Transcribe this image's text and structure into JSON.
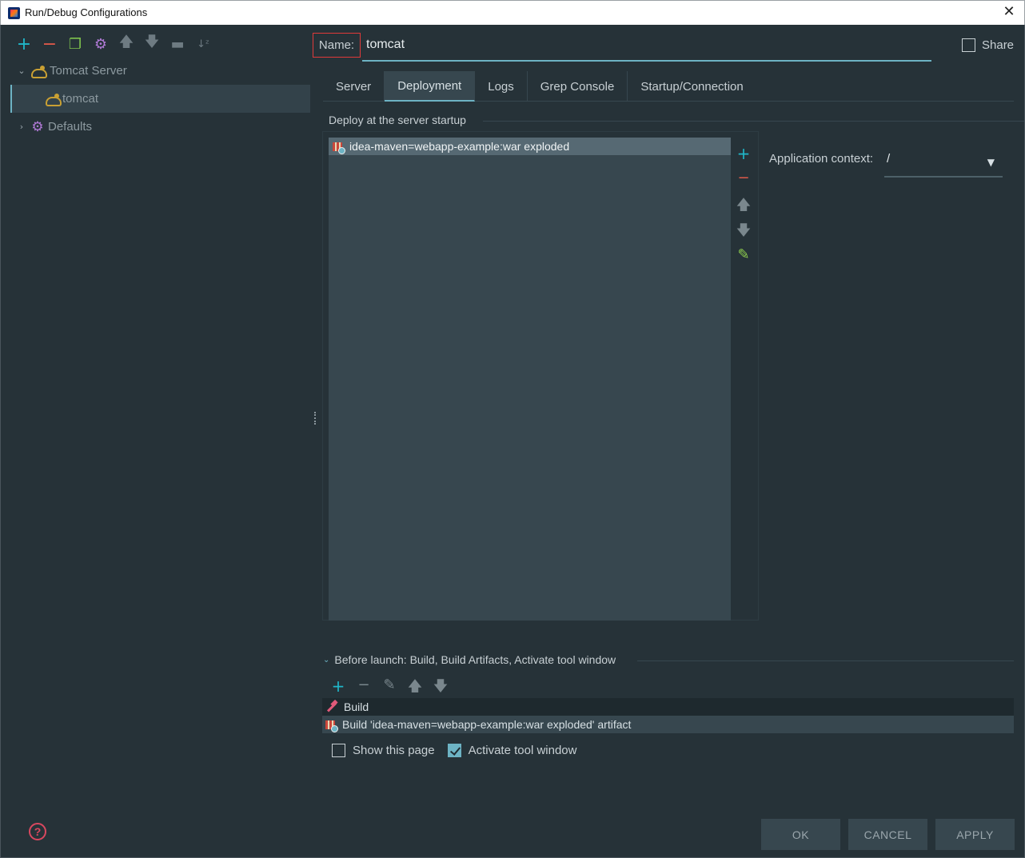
{
  "window": {
    "title": "Run/Debug Configurations"
  },
  "left_toolbar": {
    "icons": [
      "add-icon",
      "remove-icon",
      "copy-icon",
      "settings-icon",
      "move-up-icon",
      "move-down-icon",
      "folder-icon",
      "sort-icon"
    ]
  },
  "tree": {
    "items": [
      {
        "label": "Tomcat Server",
        "expanded": true,
        "icon": "tomcat-icon"
      },
      {
        "label": "tomcat",
        "selected": true,
        "icon": "tomcat-icon"
      },
      {
        "label": "Defaults",
        "expanded": false,
        "icon": "gear-icon"
      }
    ]
  },
  "name_field": {
    "label": "Name:",
    "value": "tomcat"
  },
  "share": {
    "label": "Share",
    "checked": false
  },
  "tabs": [
    {
      "label": "Server",
      "active": false
    },
    {
      "label": "Deployment",
      "active": true
    },
    {
      "label": "Logs",
      "active": false
    },
    {
      "label": "Grep Console",
      "active": false
    },
    {
      "label": "Startup/Connection",
      "active": false
    }
  ],
  "deployment": {
    "group_title": "Deploy at the server startup",
    "items": [
      "idea-maven=webapp-example:war exploded"
    ],
    "application_context_label": "Application context:",
    "application_context_value": "/"
  },
  "before_launch": {
    "title": "Before launch: Build, Build Artifacts, Activate tool window",
    "items": [
      {
        "label": "Build",
        "icon": "hammer-icon"
      },
      {
        "label": "Build 'idea-maven=webapp-example:war exploded' artifact",
        "icon": "artifact-icon",
        "selected": true
      }
    ]
  },
  "options": {
    "show_this_page": {
      "label": "Show this page",
      "checked": false
    },
    "activate_tool_window": {
      "label": "Activate tool window",
      "checked": true
    }
  },
  "buttons": {
    "ok": "OK",
    "cancel": "CANCEL",
    "apply": "APPLY"
  },
  "colors": {
    "accent": "#6db3c4",
    "background": "#263238",
    "panel": "#37474f",
    "selection": "#566973",
    "add": "#20b7c9",
    "remove": "#e05a4a",
    "highlight_border": "#e03a3a"
  }
}
